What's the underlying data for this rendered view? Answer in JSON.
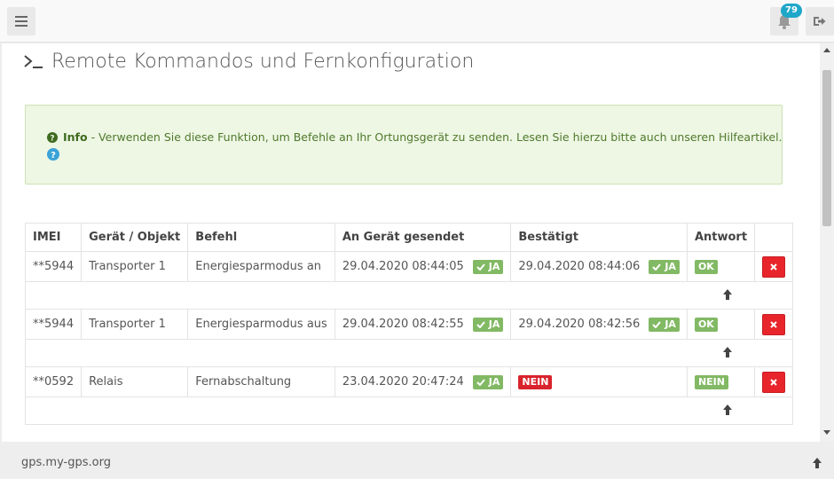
{
  "header": {
    "notification_count": "79",
    "icons": [
      "menu-icon",
      "bell-icon",
      "logout-icon"
    ]
  },
  "page": {
    "title": "Remote Kommandos und Fernkonfiguration"
  },
  "info": {
    "label": "Info",
    "text": "- Verwenden Sie diese Funktion, um Befehle an Ihr Ortungsgerät zu senden. Lesen Sie hierzu bitte auch unseren Hilfeartikel."
  },
  "table": {
    "headers": [
      "IMEI",
      "Gerät / Objekt",
      "Befehl",
      "An Gerät gesendet",
      "Bestätigt",
      "Antwort"
    ],
    "rows": [
      {
        "imei": "**5944",
        "object": "Transporter 1",
        "command": "Energiesparmodus an",
        "sent": "29.04.2020 08:44:05",
        "sent_status": "JA",
        "confirmed": "29.04.2020 08:44:06",
        "confirmed_status": "JA",
        "answer": "OK"
      },
      {
        "imei": "**5944",
        "object": "Transporter 1",
        "command": "Energiesparmodus aus",
        "sent": "29.04.2020 08:42:55",
        "sent_status": "JA",
        "confirmed": "29.04.2020 08:42:56",
        "confirmed_status": "JA",
        "answer": "OK"
      },
      {
        "imei": "**0592",
        "object": "Relais",
        "command": "Fernabschaltung",
        "sent": "23.04.2020 20:47:24",
        "sent_status": "JA",
        "confirmed": "",
        "confirmed_status": "NEIN",
        "answer": "NEIN"
      }
    ]
  },
  "footer": {
    "text": "gps.my-gps.org"
  },
  "colors": {
    "success": "#82b964",
    "danger": "#d9232c",
    "badge": "#1fa7c9",
    "alert_bg": "#eef6e4"
  }
}
